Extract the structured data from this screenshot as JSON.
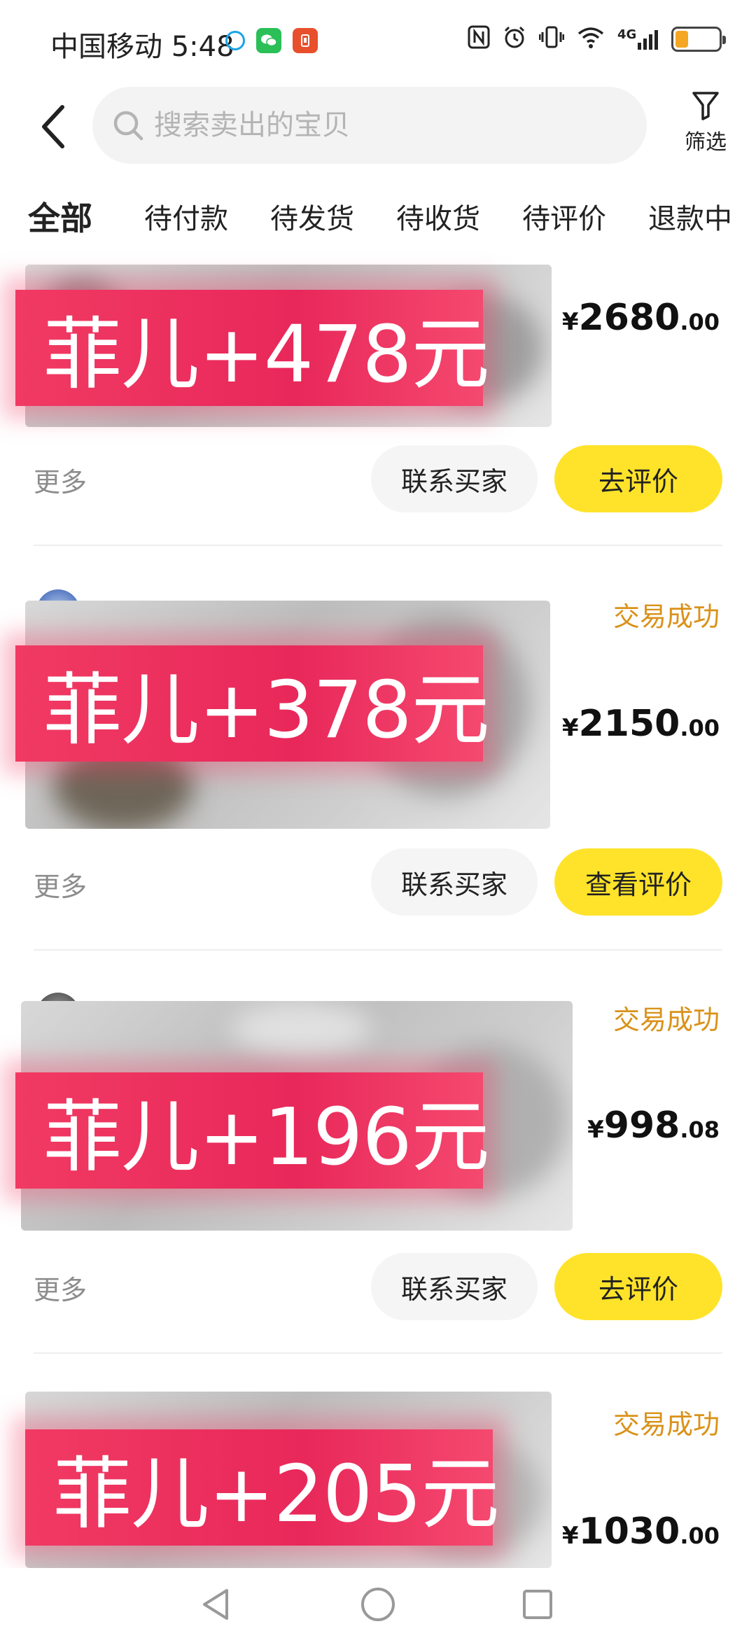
{
  "status_bar": {
    "carrier": "中国移动",
    "time": "5:48",
    "signal_label": "4G",
    "battery_level": 0.3
  },
  "header": {
    "search_placeholder": "搜索卖出的宝贝",
    "filter_label": "筛选"
  },
  "tabs": [
    {
      "label": "全部",
      "active": true
    },
    {
      "label": "待付款"
    },
    {
      "label": "待发货"
    },
    {
      "label": "待收货"
    },
    {
      "label": "待评价"
    },
    {
      "label": "退款中"
    }
  ],
  "orders": [
    {
      "status": "",
      "overlay": "菲儿+478元",
      "price_symbol": "¥",
      "price_int": "2680",
      "price_dec": ".00",
      "more_label": "更多",
      "contact_label": "联系买家",
      "action_label": "去评价"
    },
    {
      "status": "交易成功",
      "overlay": "菲儿+378元",
      "price_symbol": "¥",
      "price_int": "2150",
      "price_dec": ".00",
      "more_label": "更多",
      "contact_label": "联系买家",
      "action_label": "查看评价"
    },
    {
      "status": "交易成功",
      "overlay": "菲儿+196元",
      "price_symbol": "¥",
      "price_int": "998",
      "price_dec": ".08",
      "more_label": "更多",
      "contact_label": "联系买家",
      "action_label": "去评价"
    },
    {
      "status": "交易成功",
      "overlay": "菲儿+205元",
      "price_symbol": "¥",
      "price_int": "1030",
      "price_dec": ".00"
    }
  ],
  "colors": {
    "accent_yellow": "#ffe32a",
    "status_orange": "#d9921a",
    "overlay_red": "#e8285a"
  }
}
